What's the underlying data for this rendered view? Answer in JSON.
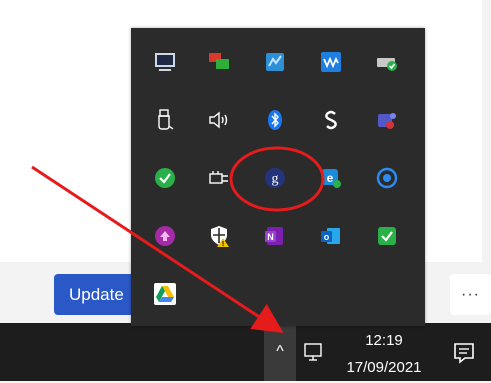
{
  "app": {
    "update_button_label": "Update",
    "more_button_label": "···"
  },
  "taskbar": {
    "chevron_glyph": "^",
    "clock": {
      "time": "12:19",
      "date": "17/09/2021"
    },
    "icons": [
      "show-hidden-icons-chevron",
      "network-icon",
      "notification-center-icon"
    ]
  },
  "tray_overflow": {
    "icons": [
      [
        "display-monitor-icon",
        "app-windows-icon",
        "network-adapter-icon",
        "wave-app-icon",
        "drive-check-icon"
      ],
      [
        "usb-device-icon",
        "speaker-volume-icon",
        "bluetooth-icon",
        "sync-s-icon",
        "teams-icon"
      ],
      [
        "green-check-icon",
        "power-plug-icon",
        "g-app-icon",
        "edge-sync-icon",
        "swirl-app-icon"
      ],
      [
        "purple-upload-icon",
        "security-shield-warning-icon",
        "onenote-icon",
        "outlook-icon",
        "green-check-square-icon"
      ],
      [
        "google-drive-icon"
      ]
    ]
  },
  "annotation": {
    "arrow_color": "#e61b1b",
    "circle_color": "#e61b1b",
    "highlighted_icon": "g-app-icon"
  },
  "colors": {
    "taskbar": "#1d1d1d",
    "tray_background": "#2b2b2b",
    "accent_button": "#2b58c7"
  }
}
